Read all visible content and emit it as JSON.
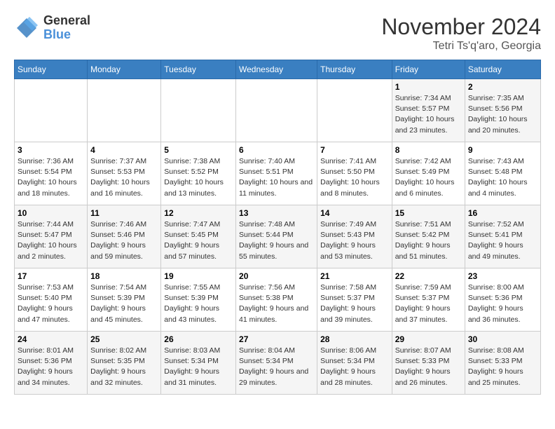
{
  "logo": {
    "line1": "General",
    "line2": "Blue"
  },
  "title": "November 2024",
  "location": "Tetri Ts'q'aro, Georgia",
  "days_header": [
    "Sunday",
    "Monday",
    "Tuesday",
    "Wednesday",
    "Thursday",
    "Friday",
    "Saturday"
  ],
  "weeks": [
    [
      {
        "day": "",
        "info": ""
      },
      {
        "day": "",
        "info": ""
      },
      {
        "day": "",
        "info": ""
      },
      {
        "day": "",
        "info": ""
      },
      {
        "day": "",
        "info": ""
      },
      {
        "day": "1",
        "info": "Sunrise: 7:34 AM\nSunset: 5:57 PM\nDaylight: 10 hours and 23 minutes."
      },
      {
        "day": "2",
        "info": "Sunrise: 7:35 AM\nSunset: 5:56 PM\nDaylight: 10 hours and 20 minutes."
      }
    ],
    [
      {
        "day": "3",
        "info": "Sunrise: 7:36 AM\nSunset: 5:54 PM\nDaylight: 10 hours and 18 minutes."
      },
      {
        "day": "4",
        "info": "Sunrise: 7:37 AM\nSunset: 5:53 PM\nDaylight: 10 hours and 16 minutes."
      },
      {
        "day": "5",
        "info": "Sunrise: 7:38 AM\nSunset: 5:52 PM\nDaylight: 10 hours and 13 minutes."
      },
      {
        "day": "6",
        "info": "Sunrise: 7:40 AM\nSunset: 5:51 PM\nDaylight: 10 hours and 11 minutes."
      },
      {
        "day": "7",
        "info": "Sunrise: 7:41 AM\nSunset: 5:50 PM\nDaylight: 10 hours and 8 minutes."
      },
      {
        "day": "8",
        "info": "Sunrise: 7:42 AM\nSunset: 5:49 PM\nDaylight: 10 hours and 6 minutes."
      },
      {
        "day": "9",
        "info": "Sunrise: 7:43 AM\nSunset: 5:48 PM\nDaylight: 10 hours and 4 minutes."
      }
    ],
    [
      {
        "day": "10",
        "info": "Sunrise: 7:44 AM\nSunset: 5:47 PM\nDaylight: 10 hours and 2 minutes."
      },
      {
        "day": "11",
        "info": "Sunrise: 7:46 AM\nSunset: 5:46 PM\nDaylight: 9 hours and 59 minutes."
      },
      {
        "day": "12",
        "info": "Sunrise: 7:47 AM\nSunset: 5:45 PM\nDaylight: 9 hours and 57 minutes."
      },
      {
        "day": "13",
        "info": "Sunrise: 7:48 AM\nSunset: 5:44 PM\nDaylight: 9 hours and 55 minutes."
      },
      {
        "day": "14",
        "info": "Sunrise: 7:49 AM\nSunset: 5:43 PM\nDaylight: 9 hours and 53 minutes."
      },
      {
        "day": "15",
        "info": "Sunrise: 7:51 AM\nSunset: 5:42 PM\nDaylight: 9 hours and 51 minutes."
      },
      {
        "day": "16",
        "info": "Sunrise: 7:52 AM\nSunset: 5:41 PM\nDaylight: 9 hours and 49 minutes."
      }
    ],
    [
      {
        "day": "17",
        "info": "Sunrise: 7:53 AM\nSunset: 5:40 PM\nDaylight: 9 hours and 47 minutes."
      },
      {
        "day": "18",
        "info": "Sunrise: 7:54 AM\nSunset: 5:39 PM\nDaylight: 9 hours and 45 minutes."
      },
      {
        "day": "19",
        "info": "Sunrise: 7:55 AM\nSunset: 5:39 PM\nDaylight: 9 hours and 43 minutes."
      },
      {
        "day": "20",
        "info": "Sunrise: 7:56 AM\nSunset: 5:38 PM\nDaylight: 9 hours and 41 minutes."
      },
      {
        "day": "21",
        "info": "Sunrise: 7:58 AM\nSunset: 5:37 PM\nDaylight: 9 hours and 39 minutes."
      },
      {
        "day": "22",
        "info": "Sunrise: 7:59 AM\nSunset: 5:37 PM\nDaylight: 9 hours and 37 minutes."
      },
      {
        "day": "23",
        "info": "Sunrise: 8:00 AM\nSunset: 5:36 PM\nDaylight: 9 hours and 36 minutes."
      }
    ],
    [
      {
        "day": "24",
        "info": "Sunrise: 8:01 AM\nSunset: 5:36 PM\nDaylight: 9 hours and 34 minutes."
      },
      {
        "day": "25",
        "info": "Sunrise: 8:02 AM\nSunset: 5:35 PM\nDaylight: 9 hours and 32 minutes."
      },
      {
        "day": "26",
        "info": "Sunrise: 8:03 AM\nSunset: 5:34 PM\nDaylight: 9 hours and 31 minutes."
      },
      {
        "day": "27",
        "info": "Sunrise: 8:04 AM\nSunset: 5:34 PM\nDaylight: 9 hours and 29 minutes."
      },
      {
        "day": "28",
        "info": "Sunrise: 8:06 AM\nSunset: 5:34 PM\nDaylight: 9 hours and 28 minutes."
      },
      {
        "day": "29",
        "info": "Sunrise: 8:07 AM\nSunset: 5:33 PM\nDaylight: 9 hours and 26 minutes."
      },
      {
        "day": "30",
        "info": "Sunrise: 8:08 AM\nSunset: 5:33 PM\nDaylight: 9 hours and 25 minutes."
      }
    ]
  ]
}
